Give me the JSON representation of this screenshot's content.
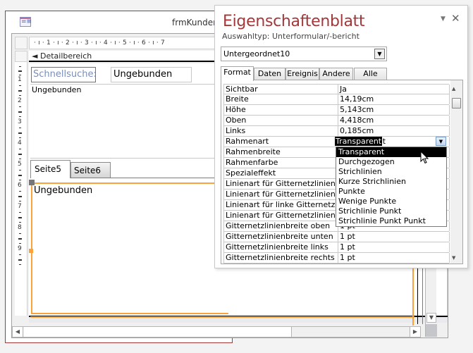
{
  "form_window": {
    "title": "frmKunden",
    "icon": "form-icon",
    "ruler_h": "· ı · 1 · ı · 2 · ı · 3 · ı · 4 · ı · 5 · ı · 6 · ı · 7",
    "ruler_v": [
      "1",
      "2",
      "3",
      "4",
      "5",
      "6",
      "7",
      "8",
      "9"
    ],
    "section_label": "Detailbereich",
    "section_icon": "section-marker-icon",
    "search_label": "Schnellsuche:",
    "search_text": "Ungebunden",
    "big_text": "Ungebunden",
    "tabs": [
      "Seite5",
      "Seite6"
    ],
    "active_tab": "Seite5",
    "subform_text": "Ungebunden",
    "accent_color": "#f9a43b"
  },
  "property_sheet": {
    "title": "Eigenschaftenblatt",
    "title_color": "#a4373a",
    "selection_type_label": "Auswahltyp:  Unterformular/-bericht",
    "object_combo_value": "Untergeordnet10",
    "tabs": [
      "Format",
      "Daten",
      "Ereignis",
      "Andere",
      "Alle"
    ],
    "active_tab": "Format",
    "rows": [
      {
        "name": "Sichtbar",
        "value": "Ja"
      },
      {
        "name": "Breite",
        "value": "14,19cm"
      },
      {
        "name": "Höhe",
        "value": "5,143cm"
      },
      {
        "name": "Oben",
        "value": "4,418cm"
      },
      {
        "name": "Links",
        "value": "0,185cm"
      },
      {
        "name": "Rahmenart",
        "value": "Transparent"
      },
      {
        "name": "Rahmenbreite",
        "value": ""
      },
      {
        "name": "Rahmenfarbe",
        "value": ""
      },
      {
        "name": "Spezialeffekt",
        "value": ""
      },
      {
        "name": "Linienart für Gitternetzlinien oben",
        "value": ""
      },
      {
        "name": "Linienart für Gitternetzlinien unten",
        "value": ""
      },
      {
        "name": "Linienart für linke Gitternetzlinien",
        "value": ""
      },
      {
        "name": "Linienart für Gitternetzlinien rechts",
        "value": ""
      },
      {
        "name": "Gitternetzlinienbreite oben",
        "value": "1 pt"
      },
      {
        "name": "Gitternetzlinienbreite unten",
        "value": "1 pt"
      },
      {
        "name": "Gitternetzlinienbreite links",
        "value": "1 pt"
      },
      {
        "name": "Gitternetzlinienbreite rechts",
        "value": "1 pt"
      }
    ],
    "rahmenart_dropdown": {
      "current": "Transparent",
      "options": [
        "Transparent",
        "Durchgezogen",
        "Strichlinien",
        "Kurze Strichlinien",
        "Punkte",
        "Wenige Punkte",
        "Strichlinie Punkt",
        "Strichlinie Punkt Punkt"
      ],
      "highlighted": "Transparent"
    }
  }
}
